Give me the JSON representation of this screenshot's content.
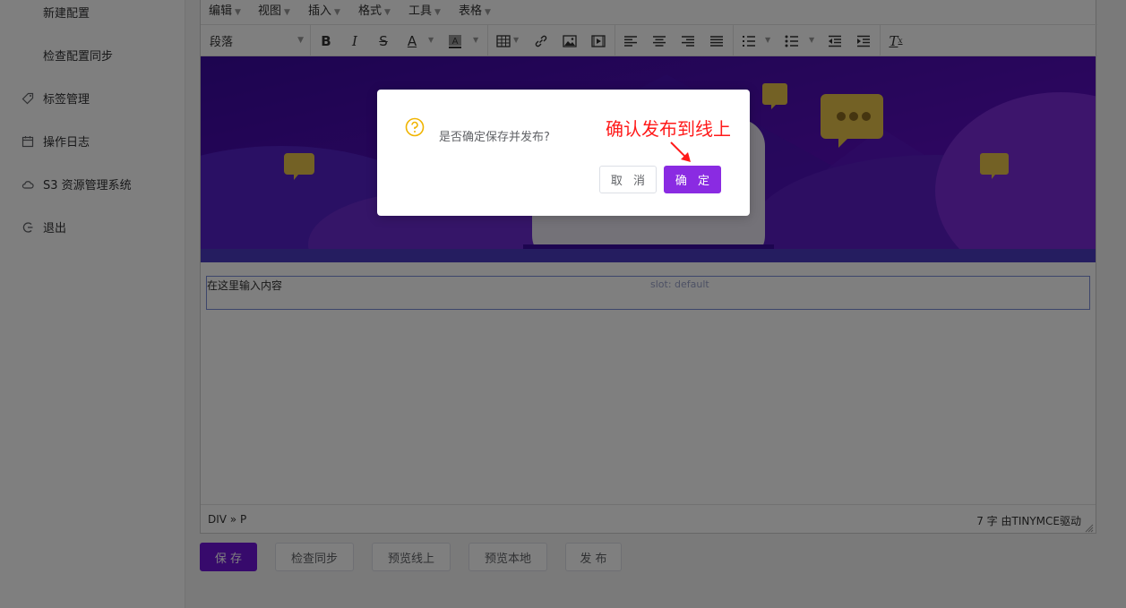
{
  "sidebar": {
    "items": [
      {
        "label": "新建配置",
        "icon": "",
        "sub": true
      },
      {
        "label": "检查配置同步",
        "icon": "",
        "sub": true
      },
      {
        "label": "标签管理",
        "icon": "tag-icon",
        "sub": false
      },
      {
        "label": "操作日志",
        "icon": "calendar-icon",
        "sub": false
      },
      {
        "label": "S3 资源管理系统",
        "icon": "cloud-icon",
        "sub": false
      },
      {
        "label": "退出",
        "icon": "logout-icon",
        "sub": false
      }
    ]
  },
  "editor": {
    "menus": [
      "编辑",
      "视图",
      "插入",
      "格式",
      "工具",
      "表格"
    ],
    "format_select": "段落",
    "content_text": "在这里输入内容",
    "slot_label": "slot: default",
    "path": "DIV » P",
    "wordcount": "7 字 由TINYMCE驱动"
  },
  "actions": {
    "save": "保 存",
    "check_sync": "检查同步",
    "preview_online": "预览线上",
    "preview_local": "预览本地",
    "publish": "发 布"
  },
  "dialog": {
    "message": "是否确定保存并发布?",
    "cancel": "取 消",
    "confirm": "确 定"
  },
  "annotation": {
    "text": "确认发布到线上",
    "color": "#ff1a1a"
  },
  "colors": {
    "primary": "#6e14d9",
    "confirm": "#8a2be2",
    "question_icon": "#f0b400"
  }
}
